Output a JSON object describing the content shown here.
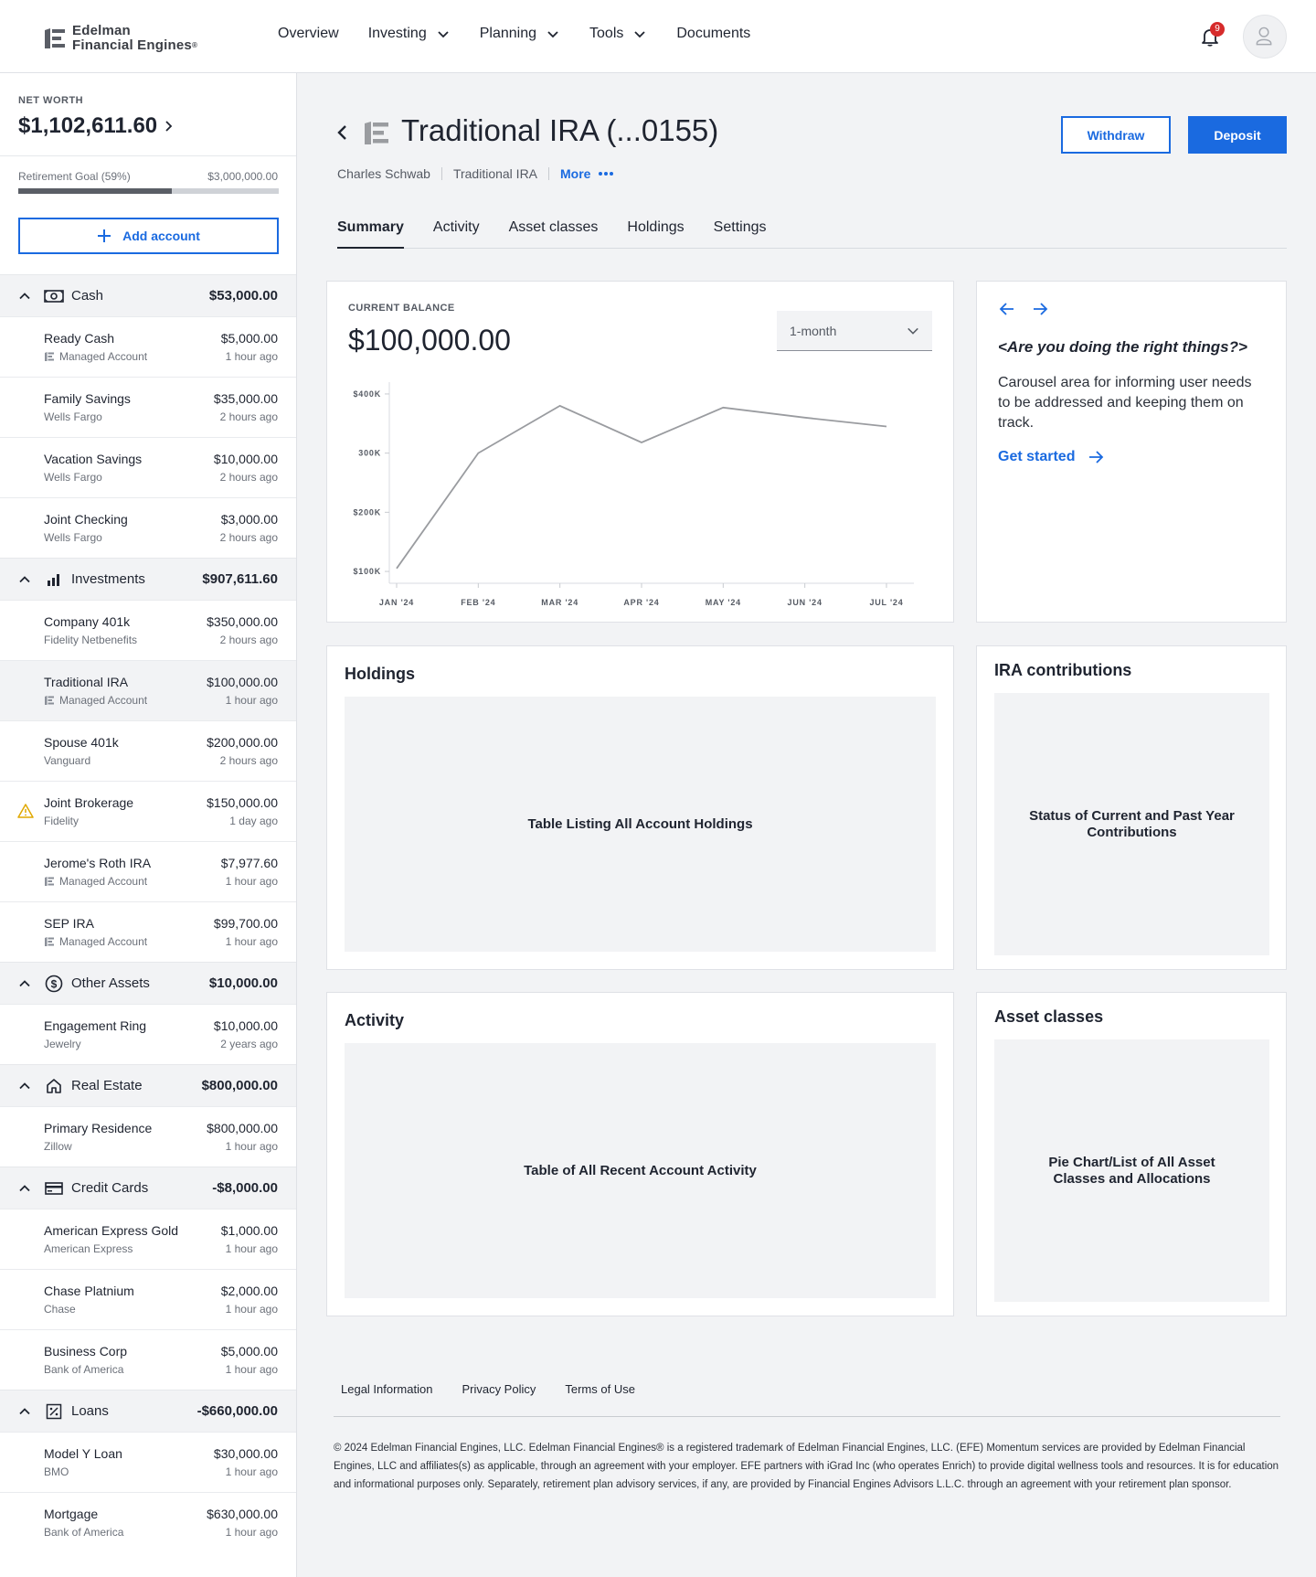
{
  "brand": {
    "line1": "Edelman",
    "line2": "Financial Engines",
    "reg": "®"
  },
  "nav": [
    {
      "label": "Overview"
    },
    {
      "label": "Investing"
    },
    {
      "label": "Planning"
    },
    {
      "label": "Tools"
    },
    {
      "label": "Documents"
    }
  ],
  "notifications": {
    "count": "9"
  },
  "sidebar": {
    "net_worth_label": "NET WORTH",
    "net_worth_value": "$1,102,611.60",
    "goal_label": "Retirement Goal (59%)",
    "goal_amount": "$3,000,000.00",
    "goal_progress": 0.59,
    "add_account_label": "Add account",
    "groups": [
      {
        "name": "Cash",
        "icon": "cash-icon",
        "total": "$53,000.00",
        "accounts": [
          {
            "name": "Ready Cash",
            "sub": "Managed Account",
            "managed": true,
            "amount": "$5,000.00",
            "time": "1 hour ago"
          },
          {
            "name": "Family Savings",
            "sub": "Wells Fargo",
            "amount": "$35,000.00",
            "time": "2 hours ago"
          },
          {
            "name": "Vacation Savings",
            "sub": "Wells Fargo",
            "amount": "$10,000.00",
            "time": "2 hours ago"
          },
          {
            "name": "Joint Checking",
            "sub": "Wells Fargo",
            "amount": "$3,000.00",
            "time": "2 hours ago"
          }
        ]
      },
      {
        "name": "Investments",
        "icon": "bar-chart-icon",
        "total": "$907,611.60",
        "accounts": [
          {
            "name": "Company 401k",
            "sub": "Fidelity Netbenefits",
            "amount": "$350,000.00",
            "time": "2 hours ago"
          },
          {
            "name": "Traditional IRA",
            "sub": "Managed Account",
            "managed": true,
            "selected": true,
            "amount": "$100,000.00",
            "time": "1 hour ago"
          },
          {
            "name": "Spouse 401k",
            "sub": "Vanguard",
            "amount": "$200,000.00",
            "time": "2 hours ago"
          },
          {
            "name": "Joint Brokerage",
            "sub": "Fidelity",
            "warning": true,
            "amount": "$150,000.00",
            "time": "1 day ago"
          },
          {
            "name": "Jerome's Roth IRA",
            "sub": "Managed Account",
            "managed": true,
            "amount": "$7,977.60",
            "time": "1 hour ago"
          },
          {
            "name": "SEP IRA",
            "sub": "Managed Account",
            "managed": true,
            "amount": "$99,700.00",
            "time": "1 hour ago"
          }
        ]
      },
      {
        "name": "Other Assets",
        "icon": "dollar-circle-icon",
        "total": "$10,000.00",
        "accounts": [
          {
            "name": "Engagement Ring",
            "sub": "Jewelry",
            "amount": "$10,000.00",
            "time": "2 years ago"
          }
        ]
      },
      {
        "name": "Real Estate",
        "icon": "house-icon",
        "total": "$800,000.00",
        "accounts": [
          {
            "name": "Primary Residence",
            "sub": "Zillow",
            "amount": "$800,000.00",
            "time": "1 hour ago"
          }
        ]
      },
      {
        "name": "Credit Cards",
        "icon": "credit-card-icon",
        "total": "-$8,000.00",
        "accounts": [
          {
            "name": "American Express Gold",
            "sub": "American Express",
            "amount": "$1,000.00",
            "time": "1 hour ago"
          },
          {
            "name": "Chase Platnium",
            "sub": "Chase",
            "amount": "$2,000.00",
            "time": "1 hour ago"
          },
          {
            "name": "Business Corp",
            "sub": "Bank of America",
            "amount": "$5,000.00",
            "time": "1 hour ago"
          }
        ]
      },
      {
        "name": "Loans",
        "icon": "percent-icon",
        "total": "-$660,000.00",
        "accounts": [
          {
            "name": "Model Y Loan",
            "sub": "BMO",
            "amount": "$30,000.00",
            "time": "1 hour ago"
          },
          {
            "name": "Mortgage",
            "sub": "Bank of America",
            "amount": "$630,000.00",
            "time": "1 hour ago"
          }
        ]
      }
    ]
  },
  "account": {
    "title": "Traditional IRA (...0155)",
    "institution": "Charles Schwab",
    "type": "Traditional IRA",
    "more_label": "More",
    "withdraw_label": "Withdraw",
    "deposit_label": "Deposit"
  },
  "tabs": [
    {
      "label": "Summary",
      "active": true
    },
    {
      "label": "Activity"
    },
    {
      "label": "Asset classes"
    },
    {
      "label": "Holdings"
    },
    {
      "label": "Settings"
    }
  ],
  "balance": {
    "label": "CURRENT BALANCE",
    "value": "$100,000.00",
    "period": "1-month"
  },
  "chart_data": {
    "type": "line",
    "title": "",
    "xlabel": "",
    "ylabel": "",
    "categories": [
      "JAN '24",
      "FEB '24",
      "MAR '24",
      "APR '24",
      "MAY '24",
      "JUN '24",
      "JUL '24"
    ],
    "values": [
      105000,
      300000,
      380000,
      318000,
      377000,
      360000,
      345000
    ],
    "ylim": [
      80000,
      420000
    ],
    "y_ticks": [
      {
        "value": 100000,
        "label": "$100K"
      },
      {
        "value": 200000,
        "label": "$200K"
      },
      {
        "value": 300000,
        "label": "300K"
      },
      {
        "value": 400000,
        "label": "$400K"
      }
    ],
    "line_color": "#9a9ca0",
    "grid": false
  },
  "carousel": {
    "question": "<Are you doing the right things?>",
    "body": "Carousel area for informing user needs to be addressed and keeping them on track.",
    "cta": "Get started"
  },
  "holdings": {
    "title": "Holdings",
    "placeholder": "Table Listing All Account Holdings"
  },
  "contributions": {
    "title": "IRA contributions",
    "placeholder": "Status of Current and Past Year Contributions"
  },
  "activity": {
    "title": "Activity",
    "placeholder": "Table of All Recent Account Activity"
  },
  "asset_classes": {
    "title": "Asset classes",
    "placeholder": "Pie Chart/List of All Asset Classes and Allocations"
  },
  "footer": {
    "links": [
      {
        "label": "Legal Information"
      },
      {
        "label": "Privacy Policy"
      },
      {
        "label": "Terms of Use"
      }
    ],
    "legal": "© 2024 Edelman Financial Engines, LLC. Edelman Financial Engines® is a registered trademark of Edelman Financial Engines, LLC. (EFE) Momentum services are provided by Edelman Financial Engines, LLC and affiliates(s) as applicable, through an agreement with your employer. EFE partners with iGrad Inc (who operates Enrich) to provide digital wellness tools and resources. It is for education and informational purposes only. Separately, retirement plan advisory services, if any, are provided by Financial Engines Advisors L.L.C. through an agreement with your retirement plan sponsor."
  }
}
